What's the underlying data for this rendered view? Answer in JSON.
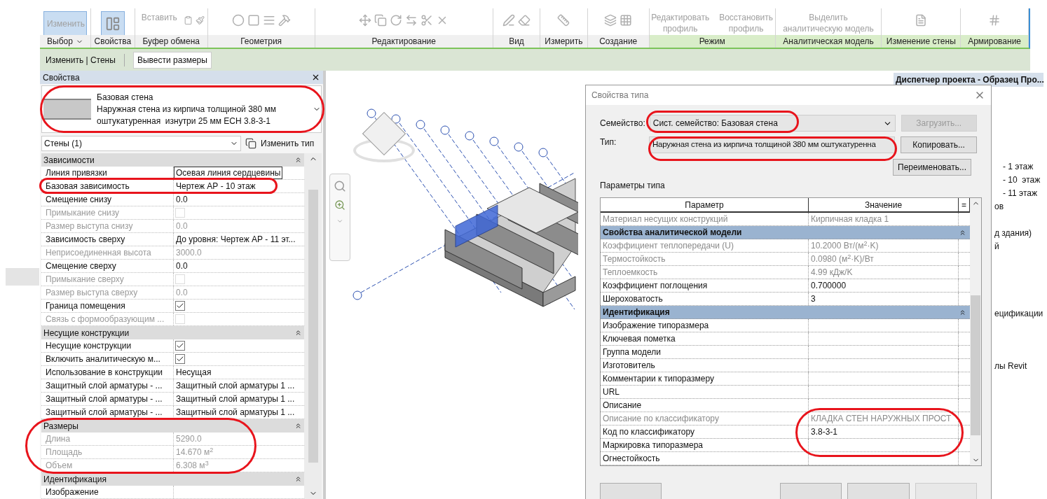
{
  "ribbon": {
    "panels": [
      {
        "label": "Выбор",
        "dropdown": true,
        "contextual": false,
        "tools": [
          {
            "kind": "text",
            "label": "Изменить",
            "selected": true
          }
        ]
      },
      {
        "label": "Свойства",
        "dropdown": false,
        "contextual": false,
        "tools": [
          {
            "kind": "icon",
            "selected": true
          }
        ]
      },
      {
        "label": "Буфер обмена",
        "dropdown": false,
        "contextual": false,
        "tools": [
          {
            "kind": "text",
            "label": "Вставить",
            "selected": false
          }
        ]
      },
      {
        "label": "Геометрия",
        "dropdown": false,
        "contextual": false
      },
      {
        "label": "Редактирование",
        "dropdown": false,
        "contextual": false
      },
      {
        "label": "Вид",
        "dropdown": false,
        "contextual": false
      },
      {
        "label": "Измерить",
        "dropdown": false,
        "contextual": false
      },
      {
        "label": "Создание",
        "dropdown": false,
        "contextual": false
      },
      {
        "label": "Режим",
        "dropdown": false,
        "contextual": true,
        "tools": [
          {
            "kind": "text",
            "label": "Редактировать профиль",
            "selected": false
          },
          {
            "kind": "text",
            "label": "Восстановить профиль",
            "selected": false
          }
        ]
      },
      {
        "label": "Аналитическая модель",
        "dropdown": false,
        "contextual": true,
        "tools": [
          {
            "kind": "text",
            "label": "Выделить аналитическую модель",
            "selected": false
          }
        ]
      },
      {
        "label": "Изменение стены",
        "dropdown": false,
        "contextual": true
      },
      {
        "label": "Армирование",
        "dropdown": false,
        "contextual": true
      }
    ]
  },
  "context_bar": {
    "label": "Изменить | Стены",
    "button": "Вывести размеры"
  },
  "properties": {
    "title": "Свойства",
    "type_family": "Базовая стена",
    "type_lines": [
      "Наружная стена из кирпича толщиной 380 мм",
      "оштукатуренная  изнутри 25 мм ЕСН 3.8-3-1"
    ],
    "filter": "Стены (1)",
    "edit_type": "Изменить тип",
    "groups": [
      {
        "title": "Зависимости",
        "rows": [
          {
            "name": "Линия привязки",
            "kind": "field",
            "value": "Осевая линия сердцевины",
            "disabled": false
          },
          {
            "name": "Базовая зависимость",
            "kind": "text",
            "value": "Чертеж АР  - 10  этаж",
            "disabled": false
          },
          {
            "name": "Смещение снизу",
            "kind": "text",
            "value": "0.0",
            "disabled": false
          },
          {
            "name": "Примыкание снизу",
            "kind": "check",
            "checked": false,
            "disabled": true
          },
          {
            "name": "Размер выступа снизу",
            "kind": "text",
            "value": "0.0",
            "disabled": true
          },
          {
            "name": "Зависимость сверху",
            "kind": "text",
            "value": "До уровня: Чертеж АР  - 11 эт...",
            "disabled": false
          },
          {
            "name": "Неприсоединенная высота",
            "kind": "text",
            "value": "3000.0",
            "disabled": true
          },
          {
            "name": "Смещение сверху",
            "kind": "text",
            "value": "0.0",
            "disabled": false
          },
          {
            "name": "Примыкание сверху",
            "kind": "check",
            "checked": false,
            "disabled": true
          },
          {
            "name": "Размер выступа сверху",
            "kind": "text",
            "value": "0.0",
            "disabled": true
          },
          {
            "name": "Граница помещения",
            "kind": "check",
            "checked": true,
            "disabled": false
          },
          {
            "name": "Связь с формообразующим ...",
            "kind": "check",
            "checked": false,
            "disabled": true
          }
        ]
      },
      {
        "title": "Несущие конструкции",
        "rows": [
          {
            "name": "Несущие конструкции",
            "kind": "check",
            "checked": true,
            "disabled": false
          },
          {
            "name": "Включить аналитическую м...",
            "kind": "check",
            "checked": true,
            "disabled": false
          },
          {
            "name": "Использование в конструкции",
            "kind": "text",
            "value": "Несущая",
            "disabled": false
          },
          {
            "name": "Защитный слой арматуры - ...",
            "kind": "text",
            "value": "Защитный слой арматуры 1 ...",
            "disabled": false
          },
          {
            "name": "Защитный слой арматуры - ...",
            "kind": "text",
            "value": "Защитный слой арматуры 1 ...",
            "disabled": false
          },
          {
            "name": "Защитный слой арматуры - ...",
            "kind": "text",
            "value": "Защитный слой арматуры 1 ...",
            "disabled": false
          }
        ]
      },
      {
        "title": "Размеры",
        "rows": [
          {
            "name": "Длина",
            "kind": "text",
            "value": "5290.0",
            "disabled": true
          },
          {
            "name": "Площадь",
            "kind": "text",
            "value": "14.670 м$^{2}$",
            "disabled": true
          },
          {
            "name": "Объем",
            "kind": "text",
            "value": "6.308 м$^{3}$",
            "disabled": true
          }
        ]
      },
      {
        "title": "Идентификация",
        "rows": [
          {
            "name": "Изображение",
            "kind": "text",
            "disabled": false
          }
        ]
      }
    ]
  },
  "project_browser": {
    "title": "Диспетчер проекта - Образец Про...",
    "items": [
      "- 1 этаж",
      "- 10  этаж",
      "- 11 этаж",
      "ов",
      "д здания)",
      "й",
      "ецификации",
      "лы Revit"
    ]
  },
  "dialog": {
    "title": "Свойства типа",
    "family_label": "Семейство:",
    "family_value": "Сист. семейство: Базовая стена",
    "load_button": {
      "label": "Загрузить...",
      "disabled": true
    },
    "type_label": "Тип:",
    "type_value": "Наружная стена из кирпича толщиной 380 мм оштукатуренна",
    "copy_button": "Копировать...",
    "rename_button": "Переименовать...",
    "section_label": "Параметры типа",
    "columns": [
      "Параметр",
      "Значение",
      "="
    ],
    "rows": [
      {
        "kind": "row",
        "name": "Материал несущих конструкций",
        "value": "Кирпичная кладка 1",
        "disabled": true
      },
      {
        "kind": "group",
        "name": "Свойства аналитической модели"
      },
      {
        "kind": "row",
        "name": "Коэффициент теплопередачи (U)",
        "value": "10.2000 Вт/(м$^{2}$·K)",
        "disabled": true
      },
      {
        "kind": "row",
        "name": "Термостойкость",
        "value": "0.0980 (м$^{2}$·K)/Вт",
        "disabled": true
      },
      {
        "kind": "row",
        "name": "Теплоемкость",
        "value": "4.99 кДж/K",
        "disabled": true
      },
      {
        "kind": "row",
        "name": "Коэффициент поглощения",
        "value": "0.700000",
        "disabled": false
      },
      {
        "kind": "row",
        "name": "Шероховатость",
        "value": "3",
        "disabled": false
      },
      {
        "kind": "group",
        "name": "Идентификация"
      },
      {
        "kind": "row",
        "name": "Изображение типоразмера",
        "disabled": false
      },
      {
        "kind": "row",
        "name": "Ключевая пометка",
        "disabled": false
      },
      {
        "kind": "row",
        "name": "Группа модели",
        "disabled": false
      },
      {
        "kind": "row",
        "name": "Изготовитель",
        "disabled": false
      },
      {
        "kind": "row",
        "name": "Комментарии к типоразмеру",
        "disabled": false
      },
      {
        "kind": "row",
        "name": "URL",
        "disabled": false
      },
      {
        "kind": "row",
        "name": "Описание",
        "disabled": false
      },
      {
        "kind": "row",
        "name": "Описание по классификатору",
        "value": "КЛАДКА СТЕН НАРУЖНЫХ ПРОСТ",
        "disabled": true
      },
      {
        "kind": "row",
        "name": "Код по классификатору",
        "value": "3.8-3-1",
        "disabled": false
      },
      {
        "kind": "row",
        "name": "Маркировка типоразмера",
        "disabled": false
      },
      {
        "kind": "row",
        "name": "Огнестойкость",
        "disabled": false
      }
    ]
  }
}
